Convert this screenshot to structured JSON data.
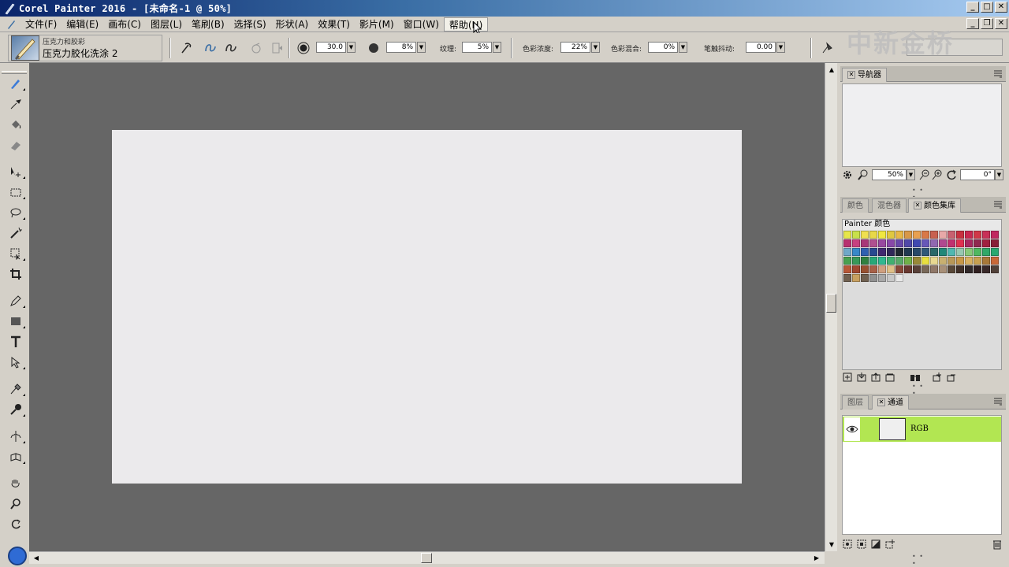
{
  "window": {
    "title": "Corel Painter 2016 - [未命名-1 @ 50%]"
  },
  "menu": [
    {
      "label": "文件(F)"
    },
    {
      "label": "编辑(E)"
    },
    {
      "label": "画布(C)"
    },
    {
      "label": "图层(L)"
    },
    {
      "label": "笔刷(B)"
    },
    {
      "label": "选择(S)"
    },
    {
      "label": "形状(A)"
    },
    {
      "label": "效果(T)"
    },
    {
      "label": "影片(M)"
    },
    {
      "label": "窗口(W)"
    },
    {
      "label": "帮助(H)"
    }
  ],
  "property_bar": {
    "brush_category": "压克力和胶彩",
    "brush_variant": "压克力胶化洗涂 2",
    "size_value": "30.0",
    "opacity_value": "8%",
    "grain_label": "纹理:",
    "grain_value": "5%",
    "resaturation_label": "色彩浓度:",
    "resaturation_value": "22%",
    "bleed_label": "色彩混合:",
    "bleed_value": "0%",
    "jitter_label": "笔触抖动:",
    "jitter_value": "0.00"
  },
  "watermark": "中新金桥",
  "navigator": {
    "tab": "导航器",
    "zoom_value": "50%",
    "rotation_value": "0°"
  },
  "color_panels": {
    "tabs": [
      "颜色",
      "混色器",
      "颜色集库"
    ],
    "active_tab": "颜色集库",
    "library_title": "Painter 颜色",
    "colors": [
      "#e6e64a",
      "#c8e04a",
      "#f0e050",
      "#e8d848",
      "#f0e840",
      "#e0c840",
      "#e8b848",
      "#d89848",
      "#e8a050",
      "#d87848",
      "#c86050",
      "#e8a8a8",
      "#c86070",
      "#c83040",
      "#c82850",
      "#d03848",
      "#c83058",
      "#c02860",
      "#b83070",
      "#c84080",
      "#a83878",
      "#b05090",
      "#9848a0",
      "#8848a8",
      "#6848a8",
      "#5048a8",
      "#4048b0",
      "#6858b8",
      "#9068b0",
      "#b04890",
      "#c03070",
      "#e03050",
      "#a82860",
      "#902850",
      "#a02040",
      "#882038",
      "#70a8c8",
      "#3888c8",
      "#3060b0",
      "#284890",
      "#402870",
      "#302858",
      "#202830",
      "#203850",
      "#284868",
      "#305878",
      "#286868",
      "#208878",
      "#50b8b0",
      "#98c8b0",
      "#88c878",
      "#50b860",
      "#30a868",
      "#28a870",
      "#48a050",
      "#389858",
      "#308040",
      "#28a878",
      "#30b890",
      "#40b070",
      "#58a868",
      "#70b048",
      "#988838",
      "#e8e040",
      "#e8d890",
      "#c8b070",
      "#b89858",
      "#c89848",
      "#d8b060",
      "#c8a050",
      "#a87838",
      "#c86838",
      "#b85838",
      "#a04830",
      "#985030",
      "#a86048",
      "#d0a080",
      "#e0c088",
      "#884838",
      "#683830",
      "#584038",
      "#786858",
      "#907868",
      "#a89078",
      "#584838",
      "#403028",
      "#302828",
      "#302020",
      "#382828",
      "#504038",
      "#706050",
      "#c8a060",
      "#706050",
      "#909090",
      "#a8a8a8",
      "#c8c8c8",
      "#e8e8e8"
    ]
  },
  "layers_panel": {
    "tabs": [
      "图层",
      "通道"
    ],
    "active_tab": "通道",
    "channel_name": "RGB"
  },
  "accent_colors": {
    "canvas_bg": "#666666",
    "paper": "#ebeaec",
    "channel_highlight": "#b2e652",
    "main_color": "#2f6bd4"
  }
}
